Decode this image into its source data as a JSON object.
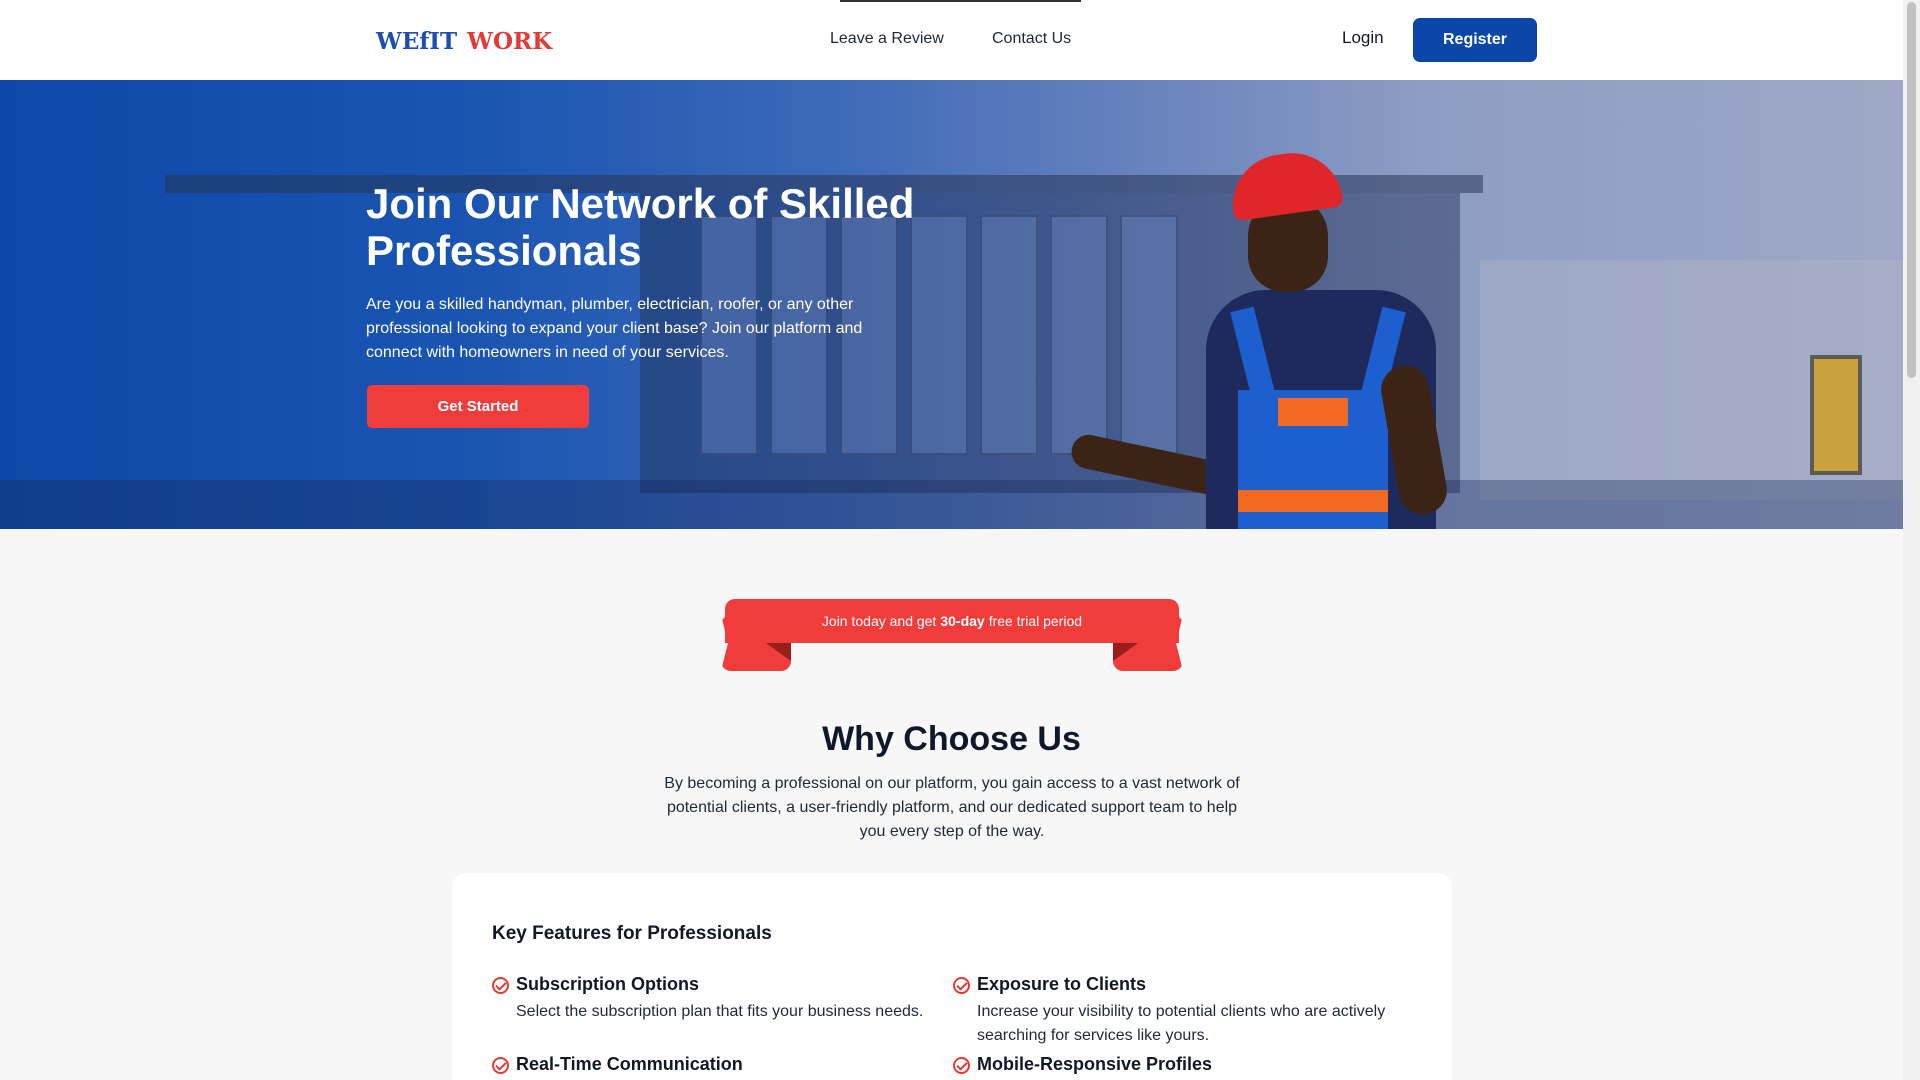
{
  "header": {
    "logo_text_blue": "WEfIT",
    "logo_text_red": "WORK",
    "nav": [
      "Leave a Review",
      "Contact Us"
    ],
    "login_label": "Login",
    "register_label": "Register"
  },
  "hero": {
    "title": "Join Our Network of Skilled Professionals",
    "description": "Are you a skilled handyman, plumber, electrician, roofer, or any other professional looking to expand your client base? Join our platform and connect with homeowners in need of your services.",
    "cta_label": "Get Started"
  },
  "ribbon": {
    "prefix": "Join today and get",
    "highlight": "30-day",
    "suffix": "free trial period"
  },
  "why": {
    "title": "Why Choose Us",
    "description": "By becoming a professional on our platform, you gain access to a vast network of potential clients, a user-friendly platform, and our dedicated support team to help you every step of the way."
  },
  "features": {
    "title": "Key Features for Professionals",
    "items": [
      {
        "title": "Subscription Options",
        "desc": "Select the subscription plan that fits your business needs."
      },
      {
        "title": "Exposure to Clients",
        "desc": "Increase your visibility to potential clients who are actively searching for services like yours."
      },
      {
        "title": "Real-Time Communication",
        "desc": ""
      },
      {
        "title": "Mobile-Responsive Profiles",
        "desc": ""
      }
    ]
  },
  "colors": {
    "brand_blue": "#0b47a8",
    "accent_red": "#f13c3c"
  }
}
